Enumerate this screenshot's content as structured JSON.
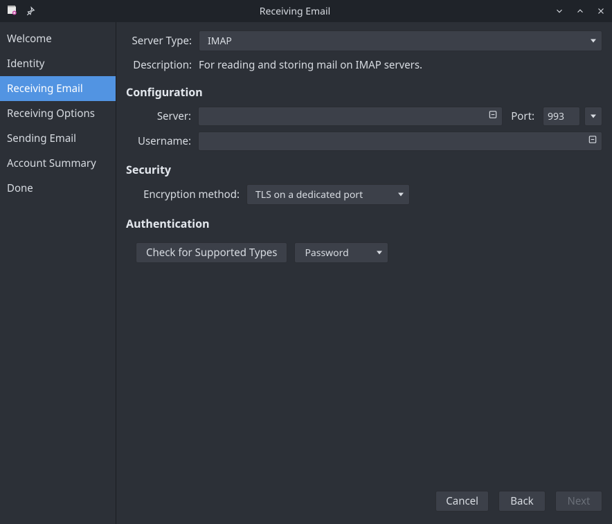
{
  "window": {
    "title": "Receiving Email"
  },
  "sidebar": {
    "items": [
      {
        "label": "Welcome"
      },
      {
        "label": "Identity"
      },
      {
        "label": "Receiving Email"
      },
      {
        "label": "Receiving Options"
      },
      {
        "label": "Sending Email"
      },
      {
        "label": "Account Summary"
      },
      {
        "label": "Done"
      }
    ],
    "active_index": 2
  },
  "form": {
    "server_type_label": "Server Type:",
    "server_type_value": "IMAP",
    "description_label": "Description:",
    "description_text": "For reading and storing mail on IMAP servers.",
    "configuration_heading": "Configuration",
    "server_label": "Server:",
    "server_value": "",
    "port_label": "Port:",
    "port_value": "993",
    "username_label": "Username:",
    "username_value": "",
    "security_heading": "Security",
    "encryption_label": "Encryption method:",
    "encryption_value": "TLS on a dedicated port",
    "authentication_heading": "Authentication",
    "check_types_label": "Check for Supported Types",
    "auth_method_value": "Password"
  },
  "footer": {
    "cancel": "Cancel",
    "back": "Back",
    "next": "Next"
  }
}
